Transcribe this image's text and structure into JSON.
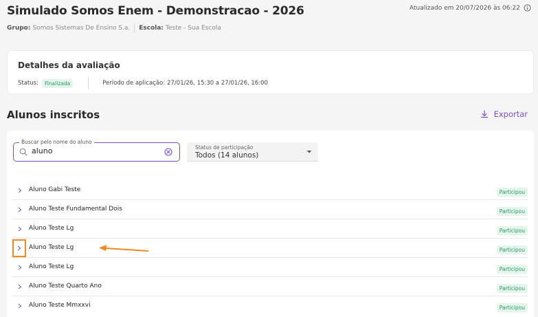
{
  "header": {
    "title": "Simulado Somos Enem - Demonstracao - 2026",
    "group_label": "Grupo:",
    "group_value": "Somos Sistemas De Ensino S.a.",
    "school_label": "Escola:",
    "school_value": "Teste - Sua Escola",
    "updated": "Atualizado em 20/07/2026 às 06:22"
  },
  "details": {
    "title": "Detalhes da avaliação",
    "status_label": "Status:",
    "status_value": "Finalizada",
    "period_label": "Período de aplicação:",
    "period_value": "27/01/26, 15:30 a 27/01/26, 16:00"
  },
  "students": {
    "title": "Alunos inscritos",
    "export_label": "Exportar",
    "search_label": "Buscar pelo nome do aluno",
    "search_value": "aluno",
    "status_filter_label": "Status de participação",
    "status_filter_value": "Todos (14 alunos)",
    "rows": [
      {
        "name": "Aluno Gabi Teste",
        "status": "Participou"
      },
      {
        "name": "Aluno Teste Fundamental Dois",
        "status": "Participou"
      },
      {
        "name": "Aluno Teste Lg",
        "status": "Participou"
      },
      {
        "name": "Aluno Teste Lg",
        "status": "Participou"
      },
      {
        "name": "Aluno Teste Lg",
        "status": "Participou"
      },
      {
        "name": "Aluno Teste Quarto Ano",
        "status": "Participou"
      },
      {
        "name": "Aluno Teste Mmxxvi",
        "status": "Participou"
      }
    ]
  },
  "colors": {
    "accent": "#7c4dcc",
    "success_bg": "#e3f5ec",
    "success_text": "#2e9a5f",
    "annotation": "#f08a1c"
  }
}
